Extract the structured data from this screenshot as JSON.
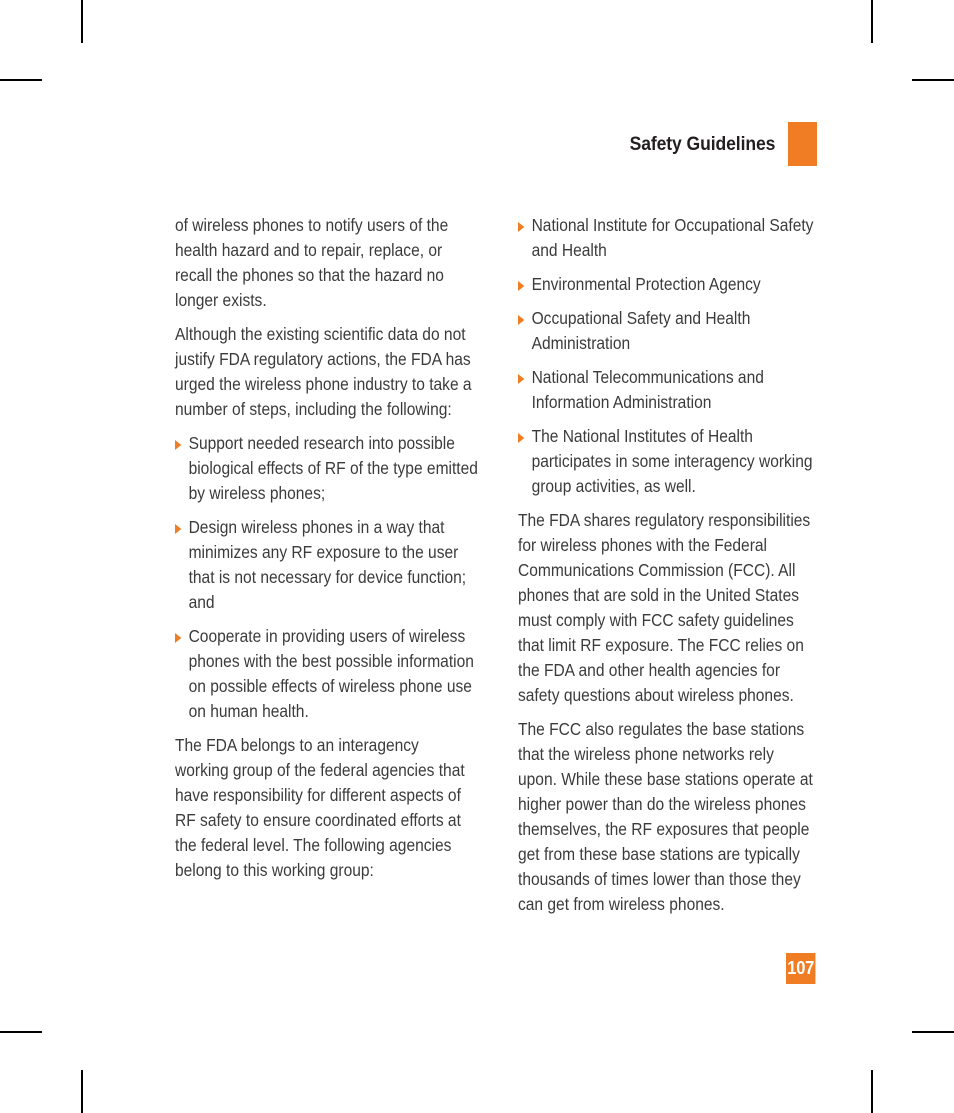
{
  "header": {
    "title": "Safety Guidelines",
    "accent_color": "#f07d23",
    "title_color": "#231f20"
  },
  "folio": {
    "page_number": "107",
    "background_color": "#f07d23",
    "text_color": "#ffffff"
  },
  "bullet_glyph": "triangle-right",
  "body_text_color": "#3b3b3c",
  "left_column": {
    "blocks": [
      {
        "type": "paragraph",
        "text": "of wireless phones to notify users of the health hazard and to repair, replace, or recall the phones so that the hazard no longer exists."
      },
      {
        "type": "paragraph",
        "text": "Although the existing scientific data do not justify FDA regulatory actions, the FDA has urged the wireless phone industry to take a number of steps, including the following:"
      },
      {
        "type": "list",
        "items": [
          "Support needed research into possible biological effects of RF of the type emitted by wireless phones;",
          "Design wireless phones in a way that minimizes any RF exposure to the user that is not necessary for device function; and",
          "Cooperate in providing users of wireless phones with the best possible information on possible effects of wireless phone use on human health."
        ]
      },
      {
        "type": "paragraph",
        "text": "The FDA belongs to an interagency working group of the federal agencies that have responsibility for different aspects of RF safety to ensure coordinated efforts at the federal level. The following agencies belong to this working group:"
      }
    ]
  },
  "right_column": {
    "blocks": [
      {
        "type": "list",
        "items": [
          "National Institute for Occupational Safety and Health",
          "Environmental Protection Agency",
          "Occupational Safety and Health Administration",
          "National Telecommunications and Information Administration",
          "The National Institutes of Health participates in some interagency working group activities, as well."
        ]
      },
      {
        "type": "paragraph",
        "text": "The FDA shares regulatory responsibilities for wireless phones with the Federal Communications Commission (FCC). All phones that are sold in the United States must comply with FCC safety guidelines that limit RF exposure. The FCC relies on the FDA and other health agencies for safety questions about wireless phones."
      },
      {
        "type": "paragraph",
        "text": "The FCC also regulates the base stations that the wireless phone networks rely upon. While these base stations operate at higher power than do the wireless phones themselves, the RF exposures that people get from these base stations are typically thousands of times lower than those they can get from wireless phones."
      }
    ]
  }
}
